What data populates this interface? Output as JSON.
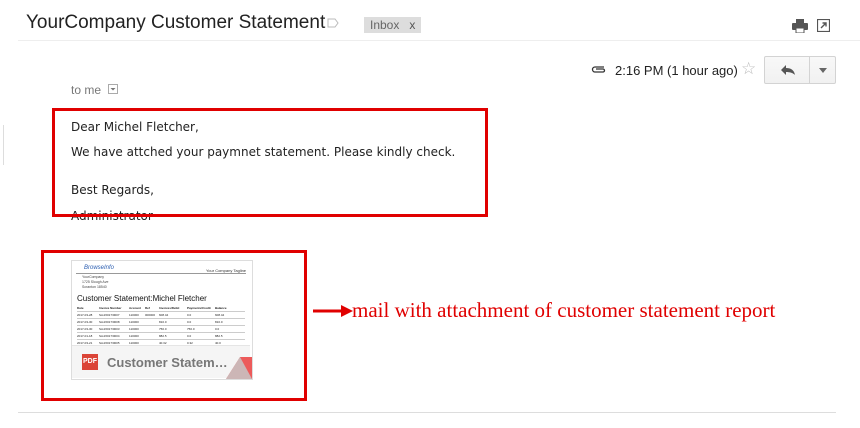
{
  "email": {
    "subject": "YourCompany Customer Statement",
    "label": "Inbox",
    "label_close": "x",
    "timestamp": "2:16 PM (1 hour ago)",
    "recipient": "to me",
    "greeting": "Dear Michel Fletcher,",
    "message": "We have attched your paymnet statement. Please kindly check.",
    "closing": "Best Regards,",
    "signature": "Administrator"
  },
  "attachment": {
    "name": "Customer Statem…",
    "type_badge": "PDF",
    "preview": {
      "logo": "BrowseInfo",
      "tagline": "Your Company Tagline",
      "address": [
        "YourCompany",
        "1725 Slough Ave",
        "Scranton 18540"
      ],
      "title": "Customer Statement:Michel Fletcher",
      "columns": [
        "Date",
        "Invoice Number",
        "Account",
        "Ref",
        "Invoices/Debit",
        "Payments/Credit",
        "Balance"
      ],
      "rows": [
        [
          "2017-03-28",
          "SAJ/2017/0007",
          "110000",
          "000000",
          "608.44",
          "0.0",
          "608.44"
        ],
        [
          "2017-03-30",
          "SAJ/2017/0008",
          "110000",
          "",
          "810.0",
          "0.0",
          "810.0"
        ],
        [
          "2017-03-30",
          "SAJ/2017/0003",
          "110000",
          "",
          "750.0",
          "750.0",
          "0.0"
        ],
        [
          "2017-01-18",
          "SAJ/2017/0004",
          "110000",
          "",
          "882.5",
          "0.0",
          "882.5"
        ],
        [
          "2017-03-21",
          "SAJ/2017/0005",
          "110000",
          "",
          "40.32",
          "0.32",
          "40.0"
        ]
      ]
    }
  },
  "annotation": {
    "text": "mail with attachment of customer statement report",
    "color": "#e00000"
  },
  "icons": [
    "label-icon",
    "print-icon",
    "popout-icon",
    "paperclip-icon",
    "star-icon",
    "reply-icon",
    "more-dropdown-icon",
    "pdf-icon"
  ]
}
